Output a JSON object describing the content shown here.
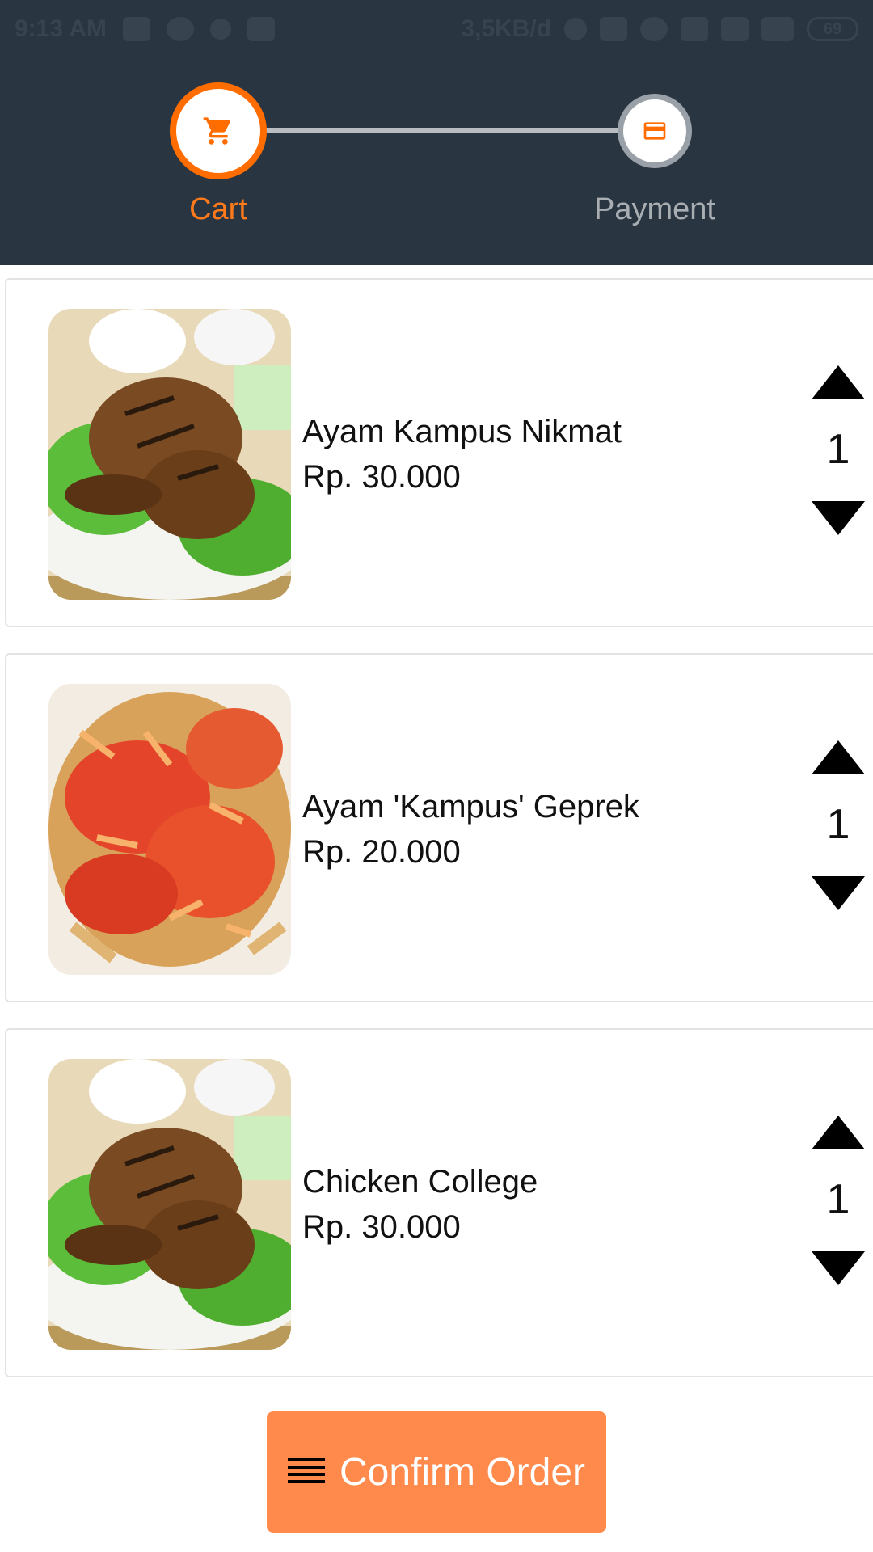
{
  "status_bar": {
    "time": "9:13 AM",
    "network_speed": "3,5KB/d",
    "battery": "69"
  },
  "stepper": {
    "steps": [
      {
        "label": "Cart",
        "icon": "cart-icon",
        "active": true
      },
      {
        "label": "Payment",
        "icon": "credit-card-icon",
        "active": false
      }
    ],
    "accent_color": "#ff6d00"
  },
  "cart": {
    "items": [
      {
        "name": "Ayam Kampus Nikmat",
        "price": "Rp. 30.000",
        "quantity": "1",
        "image": "grilled-chicken"
      },
      {
        "name": "Ayam 'Kampus' Geprek",
        "price": "Rp. 20.000",
        "quantity": "1",
        "image": "geprek-chicken"
      },
      {
        "name": "Chicken College",
        "price": "Rp. 30.000",
        "quantity": "1",
        "image": "grilled-chicken"
      }
    ]
  },
  "confirm_button": {
    "label": "Confirm Order",
    "icon": "list-icon",
    "color": "#ff8a4c"
  },
  "colors": {
    "header_bg": "#2a3542",
    "inactive": "#a9aeb3"
  }
}
